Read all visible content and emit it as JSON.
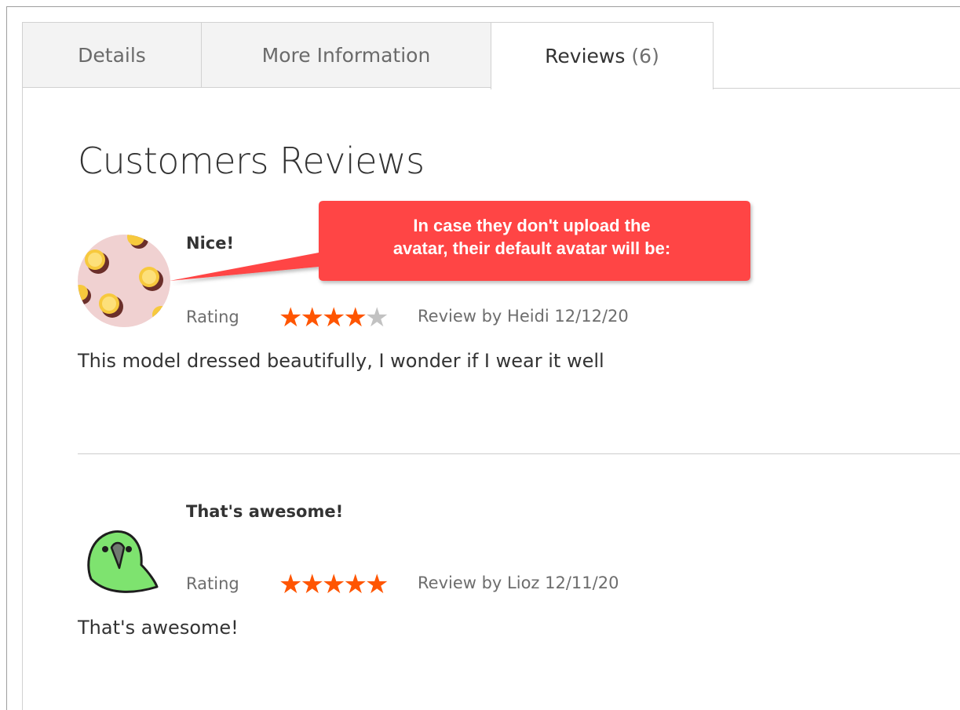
{
  "tabs": [
    {
      "label": "Details"
    },
    {
      "label": "More Information"
    },
    {
      "label": "Reviews",
      "count": "(6)",
      "active": true
    }
  ],
  "section": {
    "heading": "Customers Reviews"
  },
  "callout": {
    "line1": "In case they don't upload the",
    "line2": "avatar, their default avatar will be:",
    "color": "#ff4444"
  },
  "reviews": [
    {
      "title": "Nice!",
      "rating_label": "Rating",
      "stars": 4,
      "max_stars": 5,
      "by": "Review by Heidi 12/12/20",
      "text": "This model dressed beautifully, I wonder if I wear it well",
      "avatar": "lemon-pattern-avatar"
    },
    {
      "title": "That's awesome!",
      "rating_label": "Rating",
      "stars": 5,
      "max_stars": 5,
      "by": "Review by Lioz 12/11/20",
      "text": "That's awesome!",
      "avatar": "green-parrot-avatar"
    }
  ],
  "colors": {
    "star_on": "#ff5501",
    "star_off": "#c2c2c2"
  }
}
